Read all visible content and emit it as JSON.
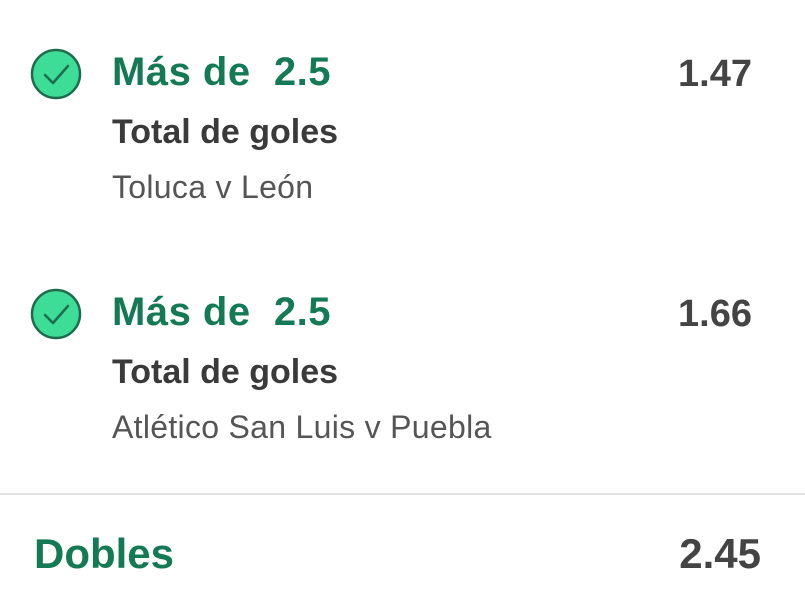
{
  "selections": [
    {
      "status_icon": "check-icon",
      "selection_name": "Más de  2.5",
      "market": "Total de goles",
      "event": "Toluca v León",
      "odds": "1.47"
    },
    {
      "status_icon": "check-icon",
      "selection_name": "Más de  2.5",
      "market": "Total de goles",
      "event": "Atlético San Luis v Puebla",
      "odds": "1.66"
    }
  ],
  "summary": {
    "label": "Dobles",
    "odds": "2.45"
  },
  "colors": {
    "accent_green": "#137a55",
    "check_fill": "#3ddc97",
    "check_stroke": "#1e6b4d",
    "text_dark": "#3a3a3a",
    "text_muted": "#555555",
    "divider": "#e2e2e2"
  }
}
